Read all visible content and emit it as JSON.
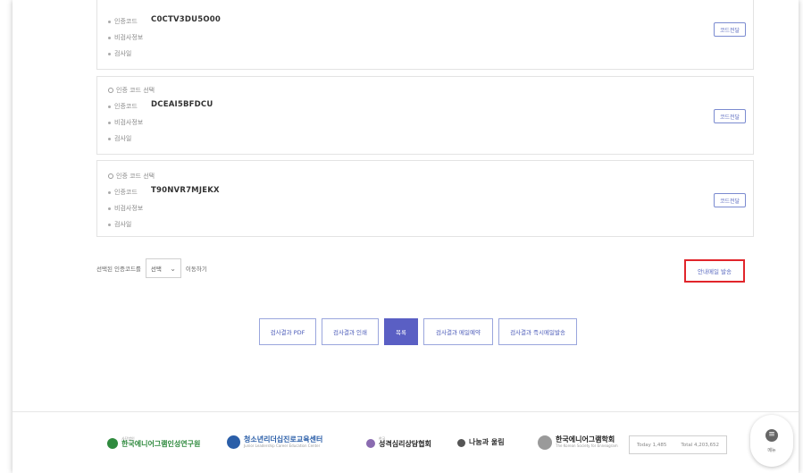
{
  "cards": [
    {
      "select_label": "",
      "code_label": "인증코드",
      "code_value": "C0CTV3DU5O00",
      "meta1": "비검사정보",
      "meta2": "검사일",
      "button": "코드전달"
    },
    {
      "select_label": "인증 코드 선택",
      "code_label": "인증코드",
      "code_value": "DCEAI5BFDCU",
      "meta1": "비검사정보",
      "meta2": "검사일",
      "button": "코드전달"
    },
    {
      "select_label": "인증 코드 선택",
      "code_label": "인증코드",
      "code_value": "T90NVR7MJEKX",
      "meta1": "비검사정보",
      "meta2": "검사일",
      "button": "코드전달"
    }
  ],
  "move": {
    "prefix": "선택된 인증코드를",
    "select_value": "선택",
    "suffix": "이동하기"
  },
  "guide_mail_button": "안내메일 발송",
  "actions": [
    {
      "label": "검사결과 PDF",
      "active": false
    },
    {
      "label": "검사결과 인쇄",
      "active": false
    },
    {
      "label": "목록",
      "active": true
    },
    {
      "label": "검사결과 메일예약",
      "active": false
    },
    {
      "label": "검사결과 즉시메일발송",
      "active": false
    }
  ],
  "footer": {
    "logos": [
      {
        "main": "한국에니어그램인성연구원",
        "sub": "사단법인",
        "color": "#2f8a3e"
      },
      {
        "main": "청소년리더십진로교육센터",
        "sub": "Junior Leadership Career Education Center",
        "color": "#2a5ea8"
      },
      {
        "main": "성격심리상담협회",
        "sub": "한국",
        "color": "#222222"
      },
      {
        "main": "나눔과 울림",
        "sub": "",
        "color": "#333333"
      },
      {
        "main": "한국에니어그램학회",
        "sub": "The Korean Society for Enneagram",
        "color": "#222222"
      }
    ],
    "today": "Today 1,485",
    "total": "Total 4,203,652",
    "menu_label": "메뉴"
  },
  "colors": {
    "accent": "#5a5fc4",
    "highlight": "#e1252b"
  }
}
